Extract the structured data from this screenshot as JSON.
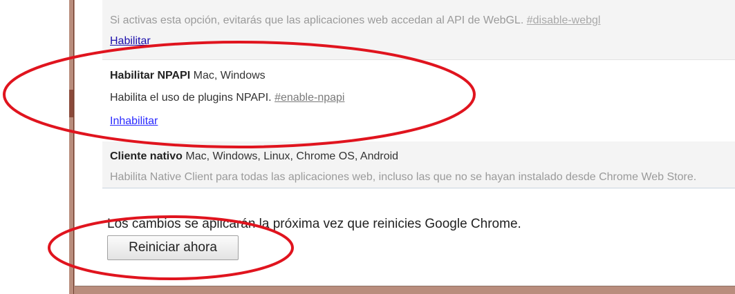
{
  "flags": {
    "webgl": {
      "description": "Si activas esta opción, evitarás que las aplicaciones web accedan al API de WebGL.",
      "hash": "#disable-webgl",
      "action": "Habilitar"
    },
    "npapi": {
      "title": "Habilitar NPAPI",
      "platforms": "Mac, Windows",
      "description": "Habilita el uso de plugins NPAPI.",
      "hash": "#enable-npapi",
      "action": "Inhabilitar"
    },
    "nacl": {
      "title": "Cliente nativo",
      "platforms": "Mac, Windows, Linux, Chrome OS, Android",
      "description": "Habilita Native Client para todas las aplicaciones web, incluso las que no se hayan instalado desde Chrome Web Store."
    }
  },
  "restart": {
    "message": "Los cambios se aplicarán la próxima vez que reinicies Google Chrome.",
    "button_label": "Reiniciar ahora"
  },
  "annotation_color": "#e0141e",
  "frame_color": "#b98d7d"
}
